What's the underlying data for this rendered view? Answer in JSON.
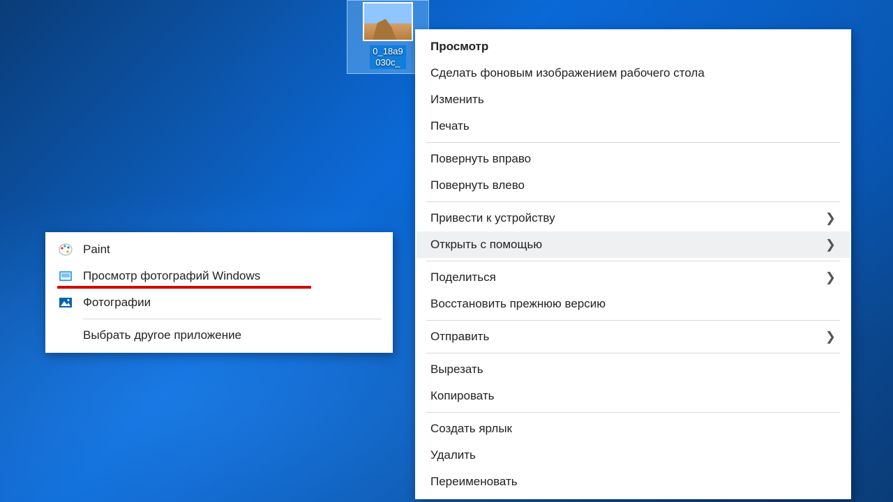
{
  "desktop": {
    "file_label_line1": "0_18a9",
    "file_label_line2": "030c_"
  },
  "context_menu": {
    "groups": [
      [
        {
          "label": "Просмотр",
          "bold": true
        },
        {
          "label": "Сделать фоновым изображением рабочего стола"
        },
        {
          "label": "Изменить"
        },
        {
          "label": "Печать"
        }
      ],
      [
        {
          "label": "Повернуть вправо"
        },
        {
          "label": "Повернуть влево"
        }
      ],
      [
        {
          "label": "Привести к устройству",
          "submenu": true
        },
        {
          "label": "Открыть с помощью",
          "submenu": true,
          "highlight": true
        }
      ],
      [
        {
          "label": "Поделиться",
          "submenu": true
        },
        {
          "label": "Восстановить прежнюю версию"
        }
      ],
      [
        {
          "label": "Отправить",
          "submenu": true
        }
      ],
      [
        {
          "label": "Вырезать"
        },
        {
          "label": "Копировать"
        }
      ],
      [
        {
          "label": "Создать ярлык"
        },
        {
          "label": "Удалить"
        },
        {
          "label": "Переименовать"
        }
      ]
    ]
  },
  "open_with_submenu": {
    "apps": [
      {
        "label": "Paint",
        "icon": "paint-icon"
      },
      {
        "label": "Просмотр фотографий Windows",
        "icon": "photo-viewer-icon",
        "underlined": true
      },
      {
        "label": "Фотографии",
        "icon": "photos-icon"
      }
    ],
    "choose_other": "Выбрать другое приложение"
  }
}
